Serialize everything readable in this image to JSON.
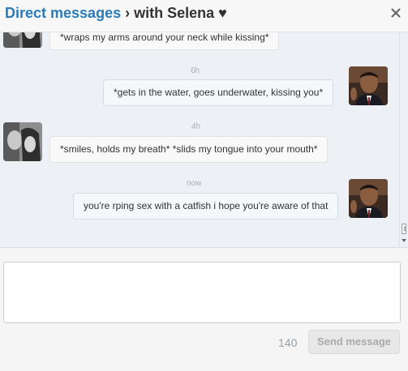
{
  "header": {
    "title_link": "Direct messages",
    "title_rest": " › with Selena ♥"
  },
  "messages": [
    {
      "sender": "selena",
      "text": "*wraps my arms around your neck while kissing*",
      "time": ""
    },
    {
      "sender": "me",
      "text": "*gets in the water, goes underwater, kissing you*",
      "time": "6h"
    },
    {
      "sender": "selena",
      "text": "*smiles, holds my breath* *slids my tongue into your mouth*",
      "time": "4h"
    },
    {
      "sender": "me",
      "text": "you're rping sex with a catfish i hope you're aware of that",
      "time": "now"
    }
  ],
  "composer": {
    "placeholder": "",
    "char_count": "140",
    "send_label": "Send message"
  },
  "colors": {
    "link": "#2b7bb9",
    "thread_bg": "#edf1f5"
  }
}
